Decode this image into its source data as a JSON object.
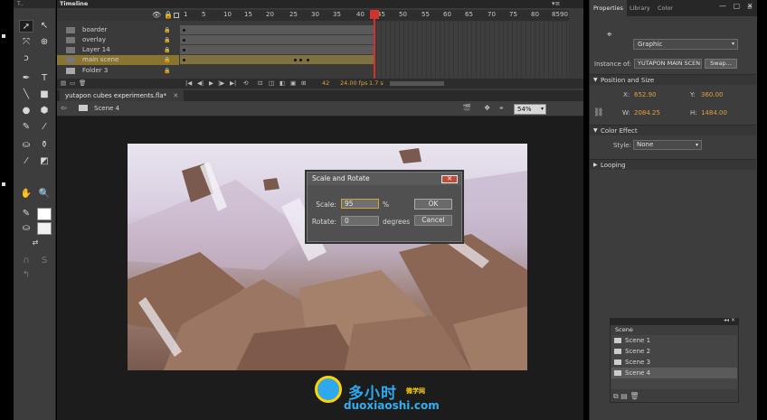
{
  "timeline": {
    "tab": "Timeline",
    "ruler": [
      "1",
      "5",
      "10",
      "15",
      "20",
      "25",
      "30",
      "35",
      "40",
      "45",
      "50",
      "55",
      "60",
      "65",
      "70",
      "75",
      "80",
      "85",
      "90"
    ],
    "layers": [
      {
        "name": "boarder"
      },
      {
        "name": "overlay"
      },
      {
        "name": "Layer 14"
      },
      {
        "name": "main scene"
      },
      {
        "name": "Folder 3"
      }
    ],
    "current_frame": "42",
    "fps": "24.00 fps",
    "elapsed": "1.7 s"
  },
  "document": {
    "tab": "yutapon cubes experiments.fla*",
    "scene": "Scene 4",
    "zoom": "54%"
  },
  "dialog": {
    "title": "Scale and Rotate",
    "close": "✕",
    "scale_label": "Scale:",
    "scale_value": "95",
    "scale_unit": "%",
    "rotate_label": "Rotate:",
    "rotate_value": "0",
    "rotate_unit": "degrees",
    "ok": "OK",
    "cancel": "Cancel"
  },
  "properties": {
    "tabs": [
      "Properties",
      "Library",
      "Color"
    ],
    "symbol_type": "Graphic",
    "instance_of_label": "Instance of:",
    "instance_of": "YUTAPON MAIN SCEN",
    "swap": "Swap...",
    "position_section": "Position and Size",
    "x_label": "X:",
    "x": "652.90",
    "y_label": "Y:",
    "y": "360.00",
    "w_label": "W:",
    "w": "2084.25",
    "h_label": "H:",
    "h": "1484.00",
    "color_effect_section": "Color Effect",
    "style_label": "Style:",
    "style": "None",
    "looping_section": "Looping"
  },
  "scene_panel": {
    "tab": "Scene",
    "scenes": [
      "Scene 1",
      "Scene 2",
      "Scene 3",
      "Scene 4"
    ],
    "selected_index": 3
  },
  "watermark": {
    "main": "多小时",
    "tag": "微学网",
    "url": "duoxiaoshi.com"
  },
  "colors": {
    "accent": "#d3a33c",
    "playhead": "#d4322a",
    "value_orange": "#e0a23a",
    "watermark_blue": "#2ea8ef"
  }
}
